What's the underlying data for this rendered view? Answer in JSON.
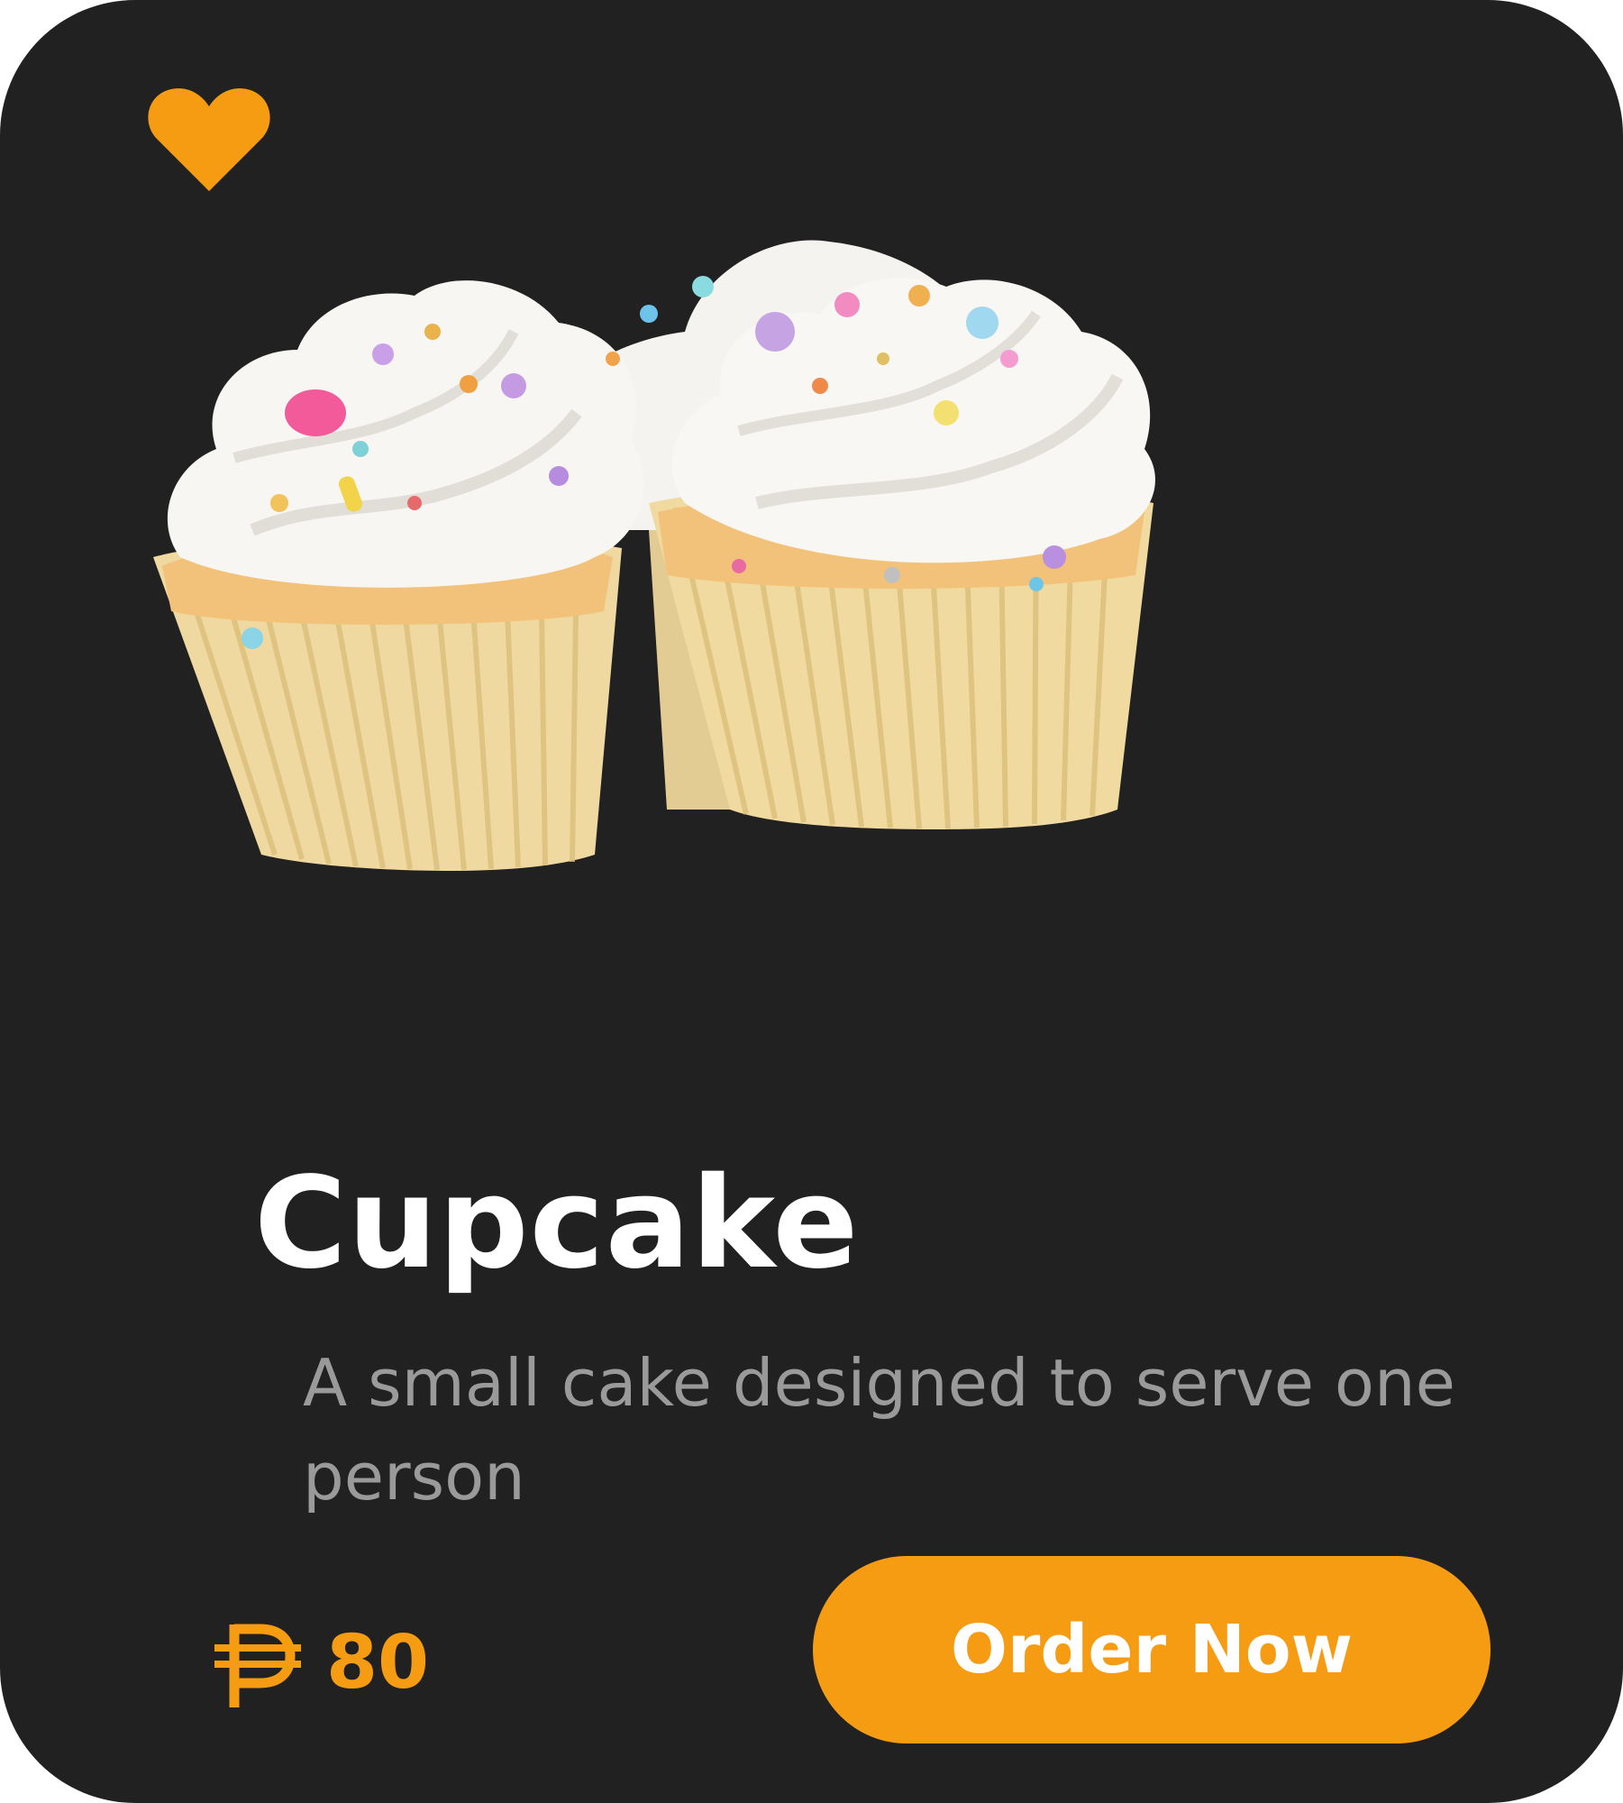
{
  "card": {
    "favorite_icon": "heart-icon",
    "image_alt": "cupcakes-photo",
    "title": "Cupcake",
    "description": "A small cake designed to serve one person",
    "price": {
      "currency_icon": "peso-sign-icon",
      "value": "80"
    },
    "order_button_label": "Order Now"
  },
  "colors": {
    "card_background": "#212121",
    "accent": "#f59c13",
    "title_text": "#ffffff",
    "description_text": "#9a9a9a",
    "button_text": "#ffffff"
  }
}
